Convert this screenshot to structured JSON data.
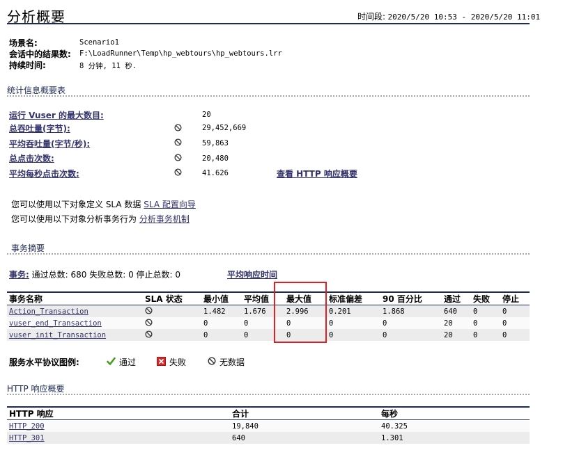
{
  "header": {
    "title": "分析概要",
    "time_label": "时间段:",
    "time_range": "2020/5/20 10:53 - 2020/5/20 11:01"
  },
  "scenario": {
    "name_label": "场景名:",
    "name_value": "Scenario1",
    "results_label": "会话中的结果数:",
    "results_value": "F:\\LoadRunner\\Temp\\hp_webtours\\hp_webtours.lrr",
    "duration_label": "持续时间:",
    "duration_value": "8 分钟, 11 秒."
  },
  "stats": {
    "section_title": "统计信息概要表",
    "rows": [
      {
        "label": "运行 Vuser 的最大数目:",
        "value": "20"
      },
      {
        "label": "总吞吐量(字节):",
        "value": "29,452,669"
      },
      {
        "label": "平均吞吐量(字节/秒):",
        "value": "59,863"
      },
      {
        "label": "总点击次数:",
        "value": "20,480"
      },
      {
        "label": "平均每秒点击次数:",
        "value": "41.626"
      }
    ],
    "http_summary_link": "查看 HTTP 响应概要"
  },
  "info": {
    "sla_text": "您可以使用以下对象定义 SLA 数据",
    "sla_link": "SLA 配置向导",
    "analyze_text": "您可以使用以下对象分析事务行为",
    "analyze_link": "分析事务机制"
  },
  "transactions": {
    "section_title": "事务摘要",
    "label": "事务:",
    "summary": "通过总数: 680 失败总数: 0 停止总数: 0",
    "avg_link": "平均响应时间",
    "columns": [
      "事务名称",
      "SLA 状态",
      "最小值",
      "平均值",
      "最大值",
      "标准偏差",
      "90 百分比",
      "通过",
      "失败",
      "停止"
    ],
    "rows": [
      {
        "name": "Action_Transaction",
        "min": "1.482",
        "avg": "1.676",
        "max": "2.996",
        "std": "0.201",
        "p90": "1.868",
        "pass": "640",
        "fail": "0",
        "stop": "0"
      },
      {
        "name": "vuser_end_Transaction",
        "min": "0",
        "avg": "0",
        "max": "0",
        "std": "0",
        "p90": "0",
        "pass": "20",
        "fail": "0",
        "stop": "0"
      },
      {
        "name": "vuser_init_Transaction",
        "min": "0",
        "avg": "0",
        "max": "0",
        "std": "0",
        "p90": "0",
        "pass": "20",
        "fail": "0",
        "stop": "0"
      }
    ]
  },
  "legend": {
    "title": "服务水平协议图例:",
    "pass": "通过",
    "fail": "失败",
    "nodata": "无数据",
    "pass_color": "#4a9a1e",
    "fail_color": "#d92b2b"
  },
  "http": {
    "section_title": "HTTP 响应概要",
    "columns": [
      "HTTP 响应",
      "合计",
      "每秒"
    ],
    "rows": [
      {
        "code": "HTTP_200",
        "total": "19,840",
        "per_sec": "40.325"
      },
      {
        "code": "HTTP_301",
        "total": "640",
        "per_sec": "1.301"
      }
    ]
  }
}
